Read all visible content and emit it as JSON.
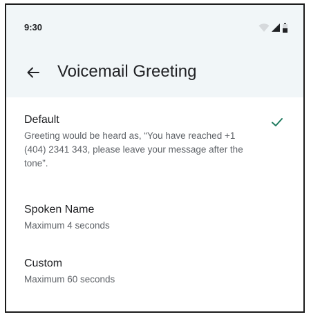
{
  "status_bar": {
    "time": "9:30",
    "icons": [
      "wifi-icon",
      "signal-icon",
      "battery-icon"
    ]
  },
  "app_bar": {
    "back_icon": "arrow-back-icon",
    "title": "Voicemail Greeting"
  },
  "options": [
    {
      "title": "Default",
      "description": "Greeting would be heard as, “You have reached  +1 (404) 2341 343, please leave your message after the tone”.",
      "selected": true
    },
    {
      "title": "Spoken Name",
      "description": "Maximum 4 seconds",
      "selected": false
    },
    {
      "title": "Custom",
      "description": "Maximum 60 seconds",
      "selected": false
    }
  ],
  "colors": {
    "header_background": "#f1f6f8",
    "check_accent": "#1e7a5e",
    "text_primary": "#202124",
    "text_secondary": "#5f6368"
  }
}
